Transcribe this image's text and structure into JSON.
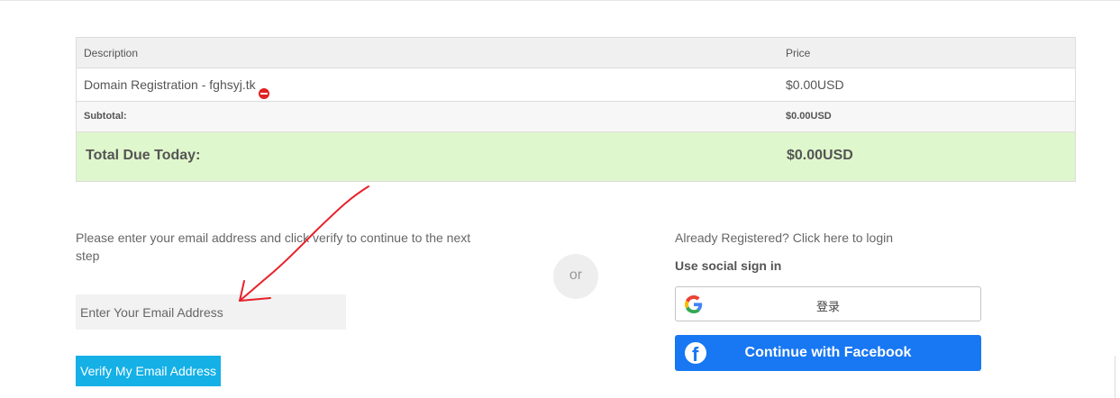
{
  "order_table": {
    "header": {
      "description": "Description",
      "price": "Price"
    },
    "item": {
      "description": "Domain Registration - fghsyj.tk",
      "price": "$0.00USD",
      "remove_icon": "remove-circle-icon"
    },
    "subtotal": {
      "label": "Subtotal:",
      "value": "$0.00USD"
    },
    "total": {
      "label": "Total Due Today:",
      "value": "$0.00USD"
    }
  },
  "verify_section": {
    "instruction": "Please enter your email address and click verify to continue to the next step",
    "email_placeholder": "Enter Your Email Address",
    "verify_button": "Verify My Email Address"
  },
  "divider": {
    "or_label": "or"
  },
  "login_section": {
    "login_link": "Already Registered? Click here to login",
    "social_heading": "Use social sign in",
    "google_button": "登录",
    "facebook_button": "Continue with Facebook"
  },
  "colors": {
    "total_bg": "#dff7cc",
    "verify_button": "#14b0e6",
    "facebook": "#1877f2",
    "remove_icon": "#e02020",
    "annotation_arrow": "#e8212a"
  }
}
